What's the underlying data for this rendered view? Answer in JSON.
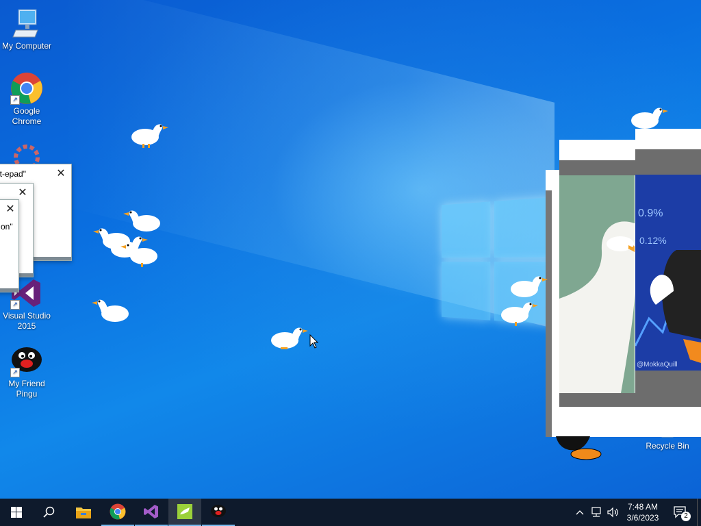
{
  "desktop": {
    "icons": [
      {
        "label": "My Computer",
        "icon": "monitor-icon"
      },
      {
        "label": "Google Chrome",
        "icon": "chrome-icon"
      },
      {
        "label": "Visual Studio 2015",
        "icon": "visual-studio-icon"
      },
      {
        "label": "My Friend Pingu",
        "icon": "pingu-icon"
      },
      {
        "label": "Recycle Bin",
        "icon": "recycle-bin-icon"
      }
    ],
    "popups": [
      {
        "title": "ot-epad\""
      },
      {
        "title": ""
      },
      {
        "title": "on\""
      }
    ],
    "meme_credit": "@MokkaQuill",
    "chart_text": {
      "a": "0.9%",
      "b": "0.12%"
    }
  },
  "taskbar": {
    "apps": [
      "start-icon",
      "search-icon",
      "file-explorer-icon",
      "chrome-icon",
      "visual-studio-icon",
      "notepad-goose-icon",
      "pingu-icon"
    ],
    "time": "7:48 AM",
    "date": "3/6/2023",
    "notification_count": "2"
  },
  "colors": {
    "accent": "#0a6fe0",
    "taskbar": "#0e1a2c"
  }
}
